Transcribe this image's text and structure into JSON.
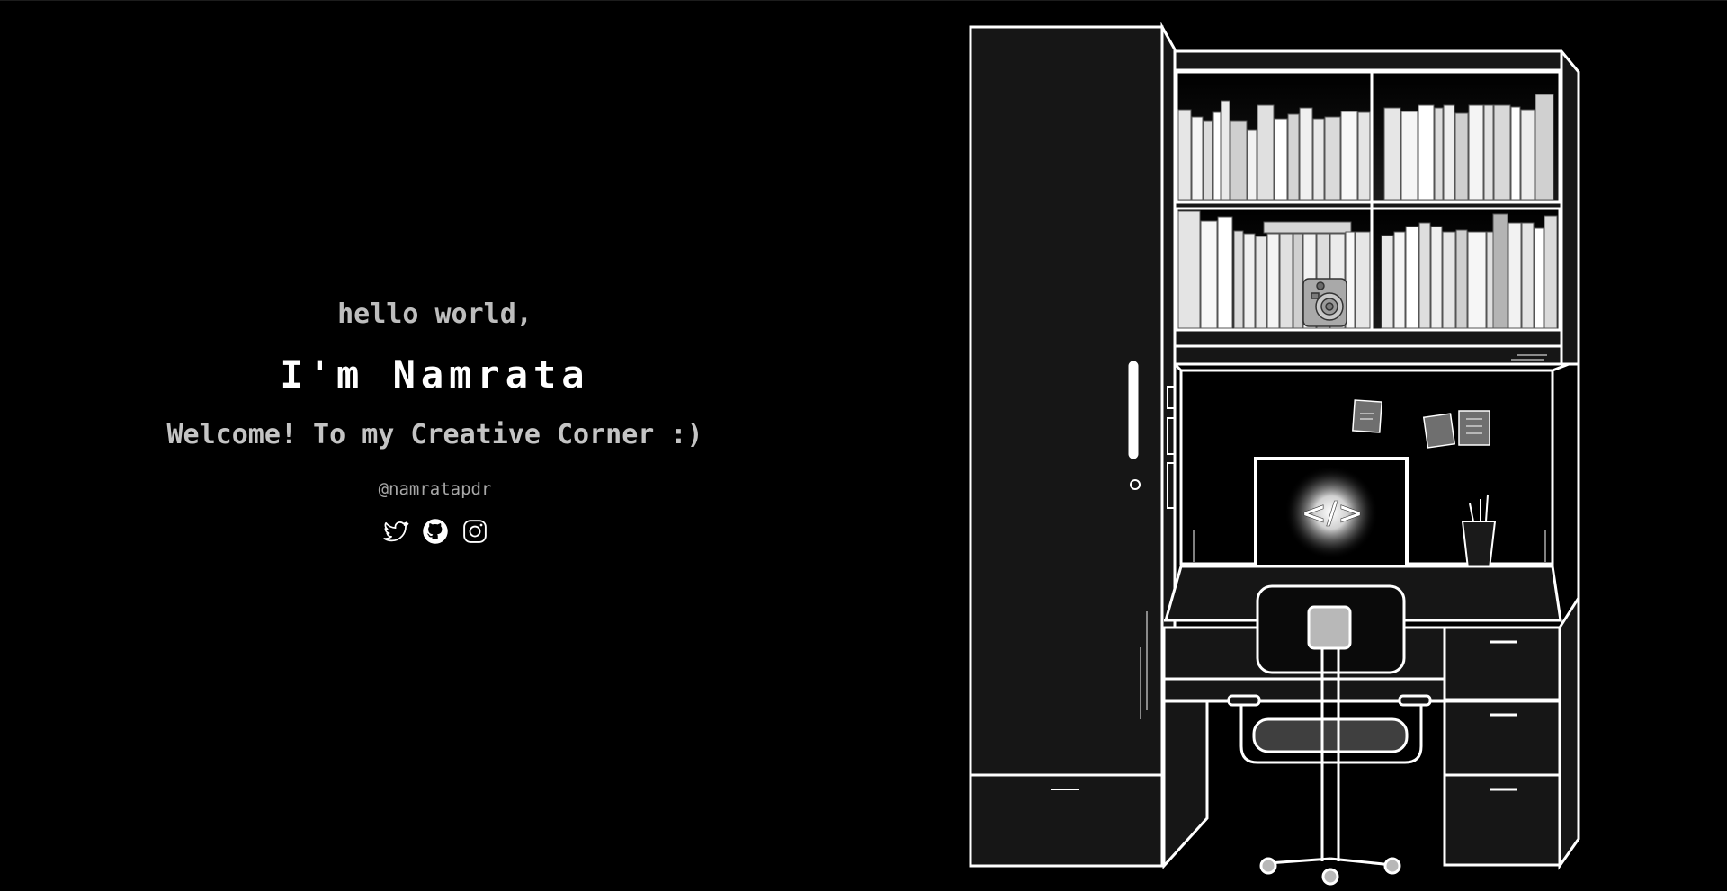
{
  "hero": {
    "greeting": "hello world,",
    "name": "I'm Namrata",
    "tagline": "Welcome! To my Creative Corner :)",
    "handle": "@namratapdr"
  },
  "socials": [
    {
      "icon": "twitter-icon"
    },
    {
      "icon": "github-icon"
    },
    {
      "icon": "instagram-icon"
    }
  ],
  "illustration": {
    "laptop_glyph": "</>"
  },
  "colors": {
    "background": "#000000",
    "furniture_fill": "#161616",
    "stroke": "#ffffff",
    "greeting": "#bdbdbd",
    "name": "#ffffff",
    "tagline": "#c4c4c4",
    "handle": "#a8a8a8"
  }
}
